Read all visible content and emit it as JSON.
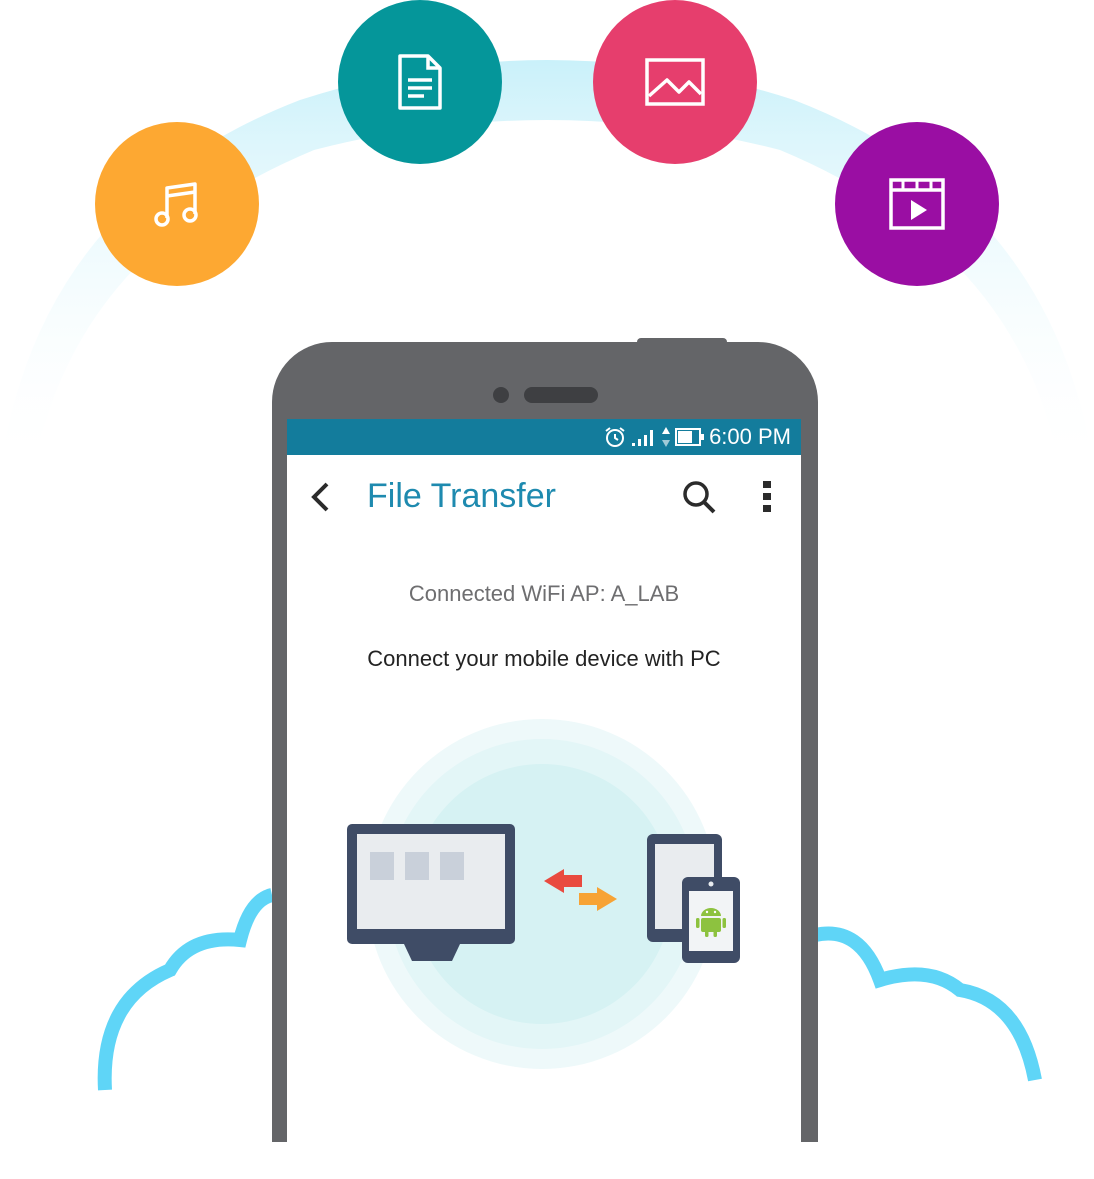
{
  "categories": [
    {
      "name": "music",
      "icon": "music-note-icon",
      "color": "#fda832"
    },
    {
      "name": "document",
      "icon": "document-icon",
      "color": "#05969a"
    },
    {
      "name": "image",
      "icon": "image-icon",
      "color": "#e63e6d"
    },
    {
      "name": "video",
      "icon": "video-icon",
      "color": "#9a0ea3"
    }
  ],
  "status_bar": {
    "time": "6:00 PM",
    "icons": [
      "alarm-icon",
      "signal-icon",
      "data-arrows-icon",
      "battery-icon"
    ],
    "color": "#137c9c"
  },
  "app_bar": {
    "title": "File Transfer",
    "title_color": "#1e8aaf"
  },
  "content": {
    "wifi_status": "Connected WiFi AP: A_LAB",
    "instruction": "Connect your mobile device with PC"
  },
  "colors": {
    "phone_body": "#646568",
    "arc": "#cdeff8",
    "cloud_outline": "#5fd5f7",
    "arrow_left": "#e94a3f",
    "arrow_right": "#f7a335",
    "monitor": "#3f4c66",
    "android": "#8dc23f"
  }
}
